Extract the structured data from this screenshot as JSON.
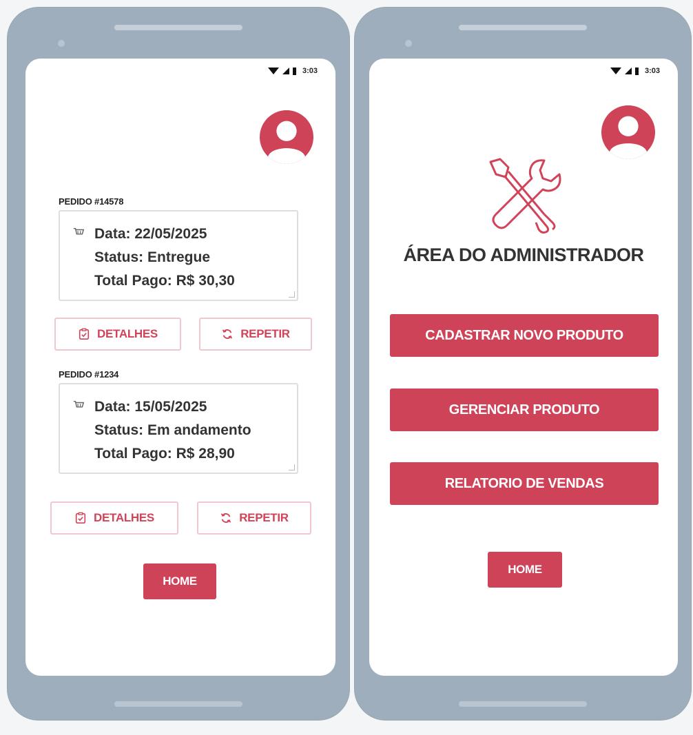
{
  "status_bar": {
    "time": "3:03"
  },
  "orders_screen": {
    "orders": [
      {
        "label": "PEDIDO #14578",
        "date": "Data: 22/05/2025",
        "status": "Status: Entregue",
        "total": "Total Pago: R$ 30,30",
        "details_label": "DETALHES",
        "repeat_label": "REPETIR"
      },
      {
        "label": "PEDIDO #1234",
        "date": "Data: 15/05/2025",
        "status": "Status: Em andamento",
        "total": "Total Pago: R$ 28,90",
        "details_label": "DETALHES",
        "repeat_label": "REPETIR"
      }
    ],
    "home_label": "HOME"
  },
  "admin_screen": {
    "title": "ÁREA DO ADMINISTRADOR",
    "buttons": [
      "CADASTRAR NOVO PRODUTO",
      "GERENCIAR PRODUTO",
      "RELATORIO DE VENDAS"
    ],
    "home_label": "HOME"
  },
  "icons": {
    "avatar": "user-avatar-icon",
    "cart": "cart-icon",
    "details": "clipboard-check-icon",
    "repeat": "refresh-icon",
    "admin": "wrench-screwdriver-icon"
  },
  "colors": {
    "accent": "#cf4359",
    "outline_border": "#f1c7ce",
    "phone_frame": "#9eaebd"
  }
}
